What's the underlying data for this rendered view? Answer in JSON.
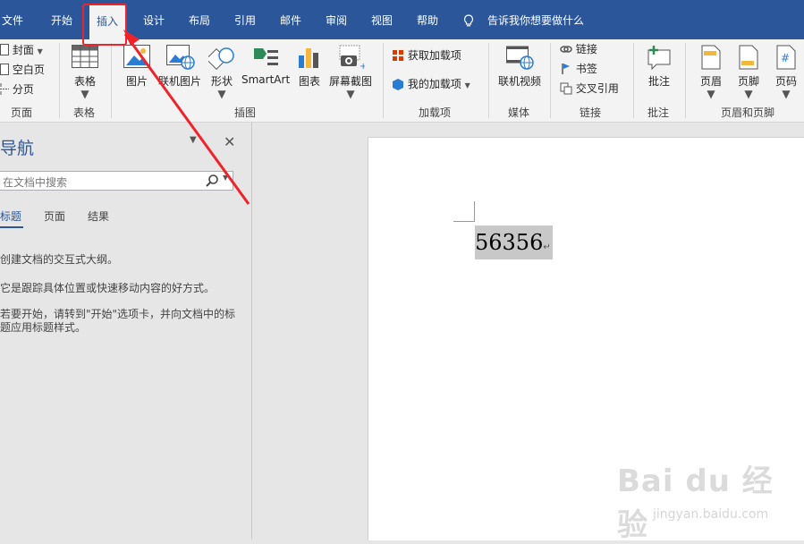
{
  "ribbon_tabs": [
    "文件",
    "开始",
    "插入",
    "设计",
    "布局",
    "引用",
    "邮件",
    "审阅",
    "视图",
    "帮助"
  ],
  "tell_me": "告诉我你想要做什么",
  "groups": {
    "pages": {
      "label": "页面",
      "items": [
        "封面",
        "空白页",
        "分页"
      ]
    },
    "tables": {
      "label": "表格",
      "button": "表格"
    },
    "illustrations": {
      "label": "插图",
      "buttons": [
        "图片",
        "联机图片",
        "形状",
        "SmartArt",
        "图表",
        "屏幕截图"
      ]
    },
    "addins": {
      "label": "加载项",
      "items": [
        "获取加载项",
        "我的加载项"
      ]
    },
    "media": {
      "label": "媒体",
      "button": "联机视频"
    },
    "links": {
      "label": "链接",
      "items": [
        "链接",
        "书签",
        "交叉引用"
      ]
    },
    "comments": {
      "label": "批注",
      "button": "批注"
    },
    "header_footer": {
      "label": "页眉和页脚",
      "buttons": [
        "页眉",
        "页脚",
        "页码"
      ]
    }
  },
  "nav": {
    "title": "导航",
    "search_placeholder": "在文档中搜索",
    "tabs": [
      "标题",
      "页面",
      "结果"
    ],
    "messages": [
      "创建文档的交互式大纲。",
      "它是跟踪具体位置或快速移动内容的好方式。",
      "若要开始，请转到\"开始\"选项卡，并向文档中的标题应用标题样式。"
    ]
  },
  "document": {
    "text": "56356"
  },
  "watermark": {
    "line1": "Bai du 经验",
    "line2": "jingyan.baidu.com"
  },
  "colors": {
    "ribbon_blue": "#2b579a",
    "annotation_red": "#f0232a"
  }
}
